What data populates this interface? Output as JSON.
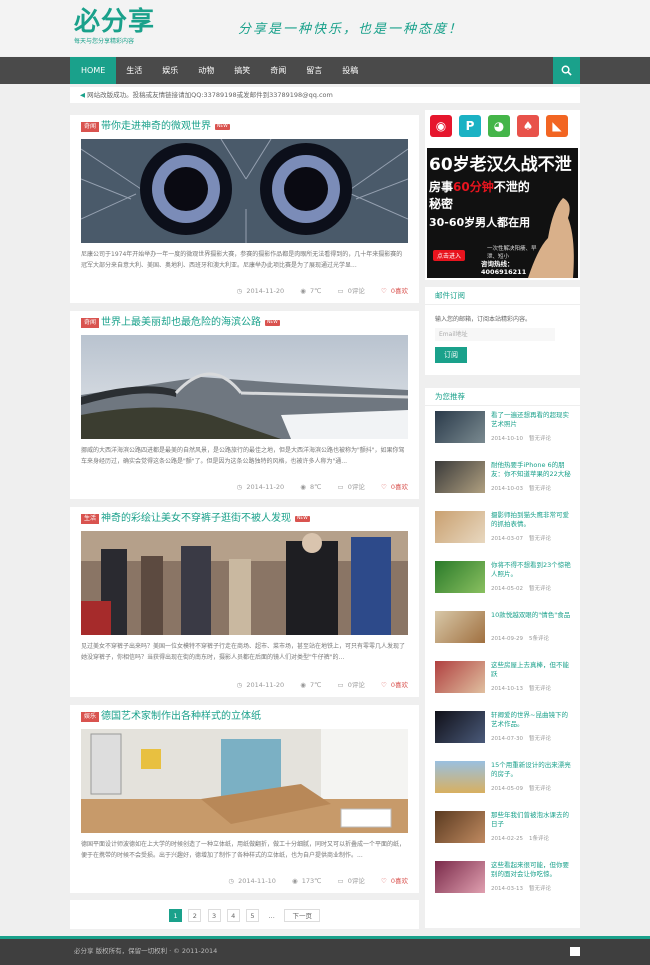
{
  "header": {
    "logo_title": "必分享",
    "logo_sub": "每天与您分享精彩内容",
    "slogan": "分享是一种快乐，也是一种态度！"
  },
  "nav": {
    "items": [
      "HOME",
      "生活",
      "娱乐",
      "动物",
      "搞笑",
      "奇闻",
      "留言",
      "投稿"
    ],
    "search_icon": "search-icon"
  },
  "notice": {
    "text": "网站改版成功。投稿或友情链接请加QQ:33789198或发邮件到33789198@qq.com"
  },
  "articles": [
    {
      "category": "奇闻",
      "title": "带你走进神奇的微观世界",
      "badge": "NEW",
      "desc": "尼康公司于1974年开始举办一年一度的微观世界摄影大赛，参赛的摄影作品都是肉眼所无法看得到的，几十年来摄影赛的冠军大部分来自意大利、美国、奥地利、西班牙和澳大利亚。尼康举办此项比赛是为了展现通过光学显...",
      "date": "2014-11-20",
      "views": "7℃",
      "comments": "0评论",
      "likes": "0喜欢"
    },
    {
      "category": "奇闻",
      "title": "世界上最美丽却也最危险的海滨公路",
      "badge": "NEW",
      "desc": "挪威的大西洋海滨公路四进都是最美的自然风景，是公路旅行的最佳之地，但是大西洋海滨公路也被称为\"颤抖\"，如果你驾车来身经历过，确实会觉得这条公路是\"颤\"了。但是因为这条公路独特的风格，也被许多人称为\"通...",
      "date": "2014-11-20",
      "views": "8℃",
      "comments": "0评论",
      "likes": "0喜欢"
    },
    {
      "category": "生活",
      "title": "神奇的彩绘让美女不穿裤子逛街不被人发现",
      "badge": "NEW",
      "desc": "见过美女不穿裤子出来吗？美国一位女模特不穿裤子行走在商场、超市、菜市场，甚至站在地铁上，可只有零零几人发现了她没穿裤子，你相信吗？当获得出现在街的南东时，摄影人员都在后面的镜人们对类型\"牛仔裤\"的...",
      "date": "2014-11-20",
      "views": "7℃",
      "comments": "0评论",
      "likes": "0喜欢"
    },
    {
      "category": "娱乐",
      "title": "德国艺术家制作出各种样式的立体纸",
      "badge": "",
      "desc": "德国平面设计师波德如在上大学的时候创造了一种立体纸，用纸做翻折，做工十分细腻，同时又可以折叠成一个平面的纸，便于在携带的时候不会受损。出于兴趣好，德增加了制作了各种样式的立体纸，也为自户提供商业制作。...",
      "date": "2014-11-10",
      "views": "173℃",
      "comments": "0评论",
      "likes": "0喜欢"
    }
  ],
  "pagination": {
    "pages": [
      "1",
      "2",
      "3",
      "4",
      "5"
    ],
    "dots": "...",
    "next": "下一页"
  },
  "footer": {
    "text": "必分享 版权所有，保留一切权利 · © 2011-2014"
  },
  "sidebar": {
    "social": [
      {
        "icon": "weibo-icon",
        "glyph": "◉",
        "color": "#e6162d"
      },
      {
        "icon": "pinterest-icon",
        "glyph": "P",
        "color": "#1bb2c4"
      },
      {
        "icon": "wechat-icon",
        "glyph": "◕",
        "color": "#44b549"
      },
      {
        "icon": "qq-icon",
        "glyph": "♠",
        "color": "#e8524a"
      },
      {
        "icon": "rss-icon",
        "glyph": "◣",
        "color": "#f26522"
      }
    ],
    "ad": {
      "headline": "60岁老汉久战不泄",
      "line1_pre": "房事",
      "line1_red": "60分钟",
      "line1_post": "不泄的秘密",
      "line2": "30-60岁男人都在用",
      "small": "一次性解决阳痿、早泄、短小",
      "button": "点击进入",
      "tel": "咨询热线：4006916211"
    },
    "subscribe": {
      "title": "邮件订阅",
      "text": "输入您的邮箱，订阅本站精彩内容。",
      "placeholder": "Email地址",
      "button": "订阅"
    },
    "recommend": {
      "title": "为您推荐",
      "items": [
        {
          "title": "看了一遍还想再看的超现实艺术照片",
          "date": "2014-10-10",
          "comments": "暂无评论"
        },
        {
          "title": "耐他热要手iPhone 6的朋友：你不知道苹果的22大秘密",
          "date": "2014-10-03",
          "comments": "暂无评论"
        },
        {
          "title": "摄影师拍到猫头鹰非常可爱的抓拍表情。",
          "date": "2014-03-07",
          "comments": "暂无评论"
        },
        {
          "title": "你将不得不想看到23个惊艳人照片。",
          "date": "2014-05-02",
          "comments": "暂无评论"
        },
        {
          "title": "10款悦越双眼的\"情色\"食品",
          "date": "2014-09-29",
          "comments": "5条评论"
        },
        {
          "title": "这些房屋上去真棒，但不能跃",
          "date": "2014-10-13",
          "comments": "暂无评论"
        },
        {
          "title": "轩卿爱的世界~昆曲镜下的艺术作品。",
          "date": "2014-07-30",
          "comments": "暂无评论"
        },
        {
          "title": "15个用重新设计的出来漂亮的房子。",
          "date": "2014-05-09",
          "comments": "暂无评论"
        },
        {
          "title": "那些年我们曾被泡水课去的日子",
          "date": "2014-02-25",
          "comments": "1条评论"
        },
        {
          "title": "这些看起来很可能，但你要别的面对会让你吃惊。",
          "date": "2014-03-13",
          "comments": "暂无评论"
        }
      ]
    }
  }
}
